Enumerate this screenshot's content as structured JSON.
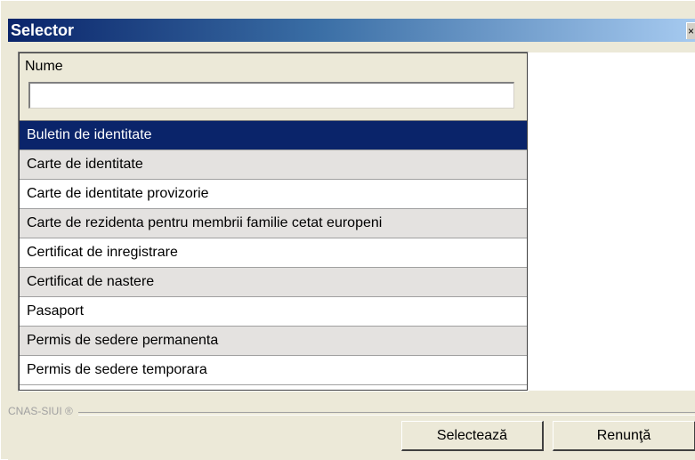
{
  "window": {
    "title": "Selector",
    "close_glyph": "×"
  },
  "grid": {
    "column_header": "Nume",
    "filter_value": "",
    "rows": [
      "Buletin de identitate",
      "Carte de identitate",
      "Carte de identitate provizorie",
      "Carte de rezidenta pentru membrii familie cetat europeni",
      "Certificat de inregistrare",
      "Certificat de nastere",
      "Pasaport",
      "Permis de sedere permanenta",
      "Permis de sedere temporara"
    ],
    "selected_row": "Buletin de identitate"
  },
  "footer": {
    "brand": "CNAS-SIUI ®",
    "select_label": "Selectează",
    "cancel_label": "Renunţă"
  },
  "colors": {
    "title_bar": "#0a246a",
    "selection": "#0a246a",
    "alt_row": "#e4e2e0",
    "dialog_bg": "#ece9d8"
  }
}
